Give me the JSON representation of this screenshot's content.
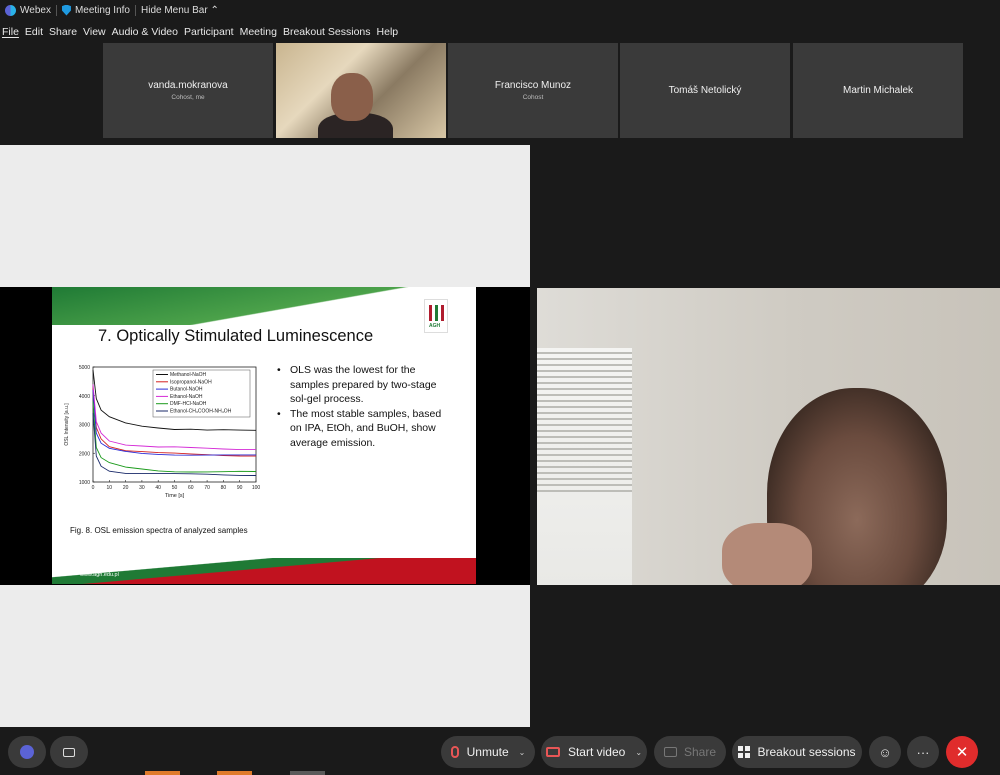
{
  "titlebar": {
    "app_name": "Webex",
    "meeting_info": "Meeting Info",
    "hide_menu": "Hide Menu Bar ⌃"
  },
  "menu": [
    "File",
    "Edit",
    "Share",
    "View",
    "Audio & Video",
    "Participant",
    "Meeting",
    "Breakout Sessions",
    "Help"
  ],
  "participants": [
    {
      "name": "vanda.mokranova",
      "role": "Cohost, me"
    },
    {
      "name": "",
      "role": "",
      "video": true
    },
    {
      "name": "Francisco Munoz",
      "role": "Cohost"
    },
    {
      "name": "Tomáš Netolický",
      "role": ""
    },
    {
      "name": "Martin Michalek",
      "role": ""
    }
  ],
  "slide": {
    "title": "7. Optically Stimulated Luminescence",
    "bullets": [
      "OLS was the lowest for the samples prepared by two-stage sol-gel process.",
      "The most stable samples, based on IPA, EtOh, and BuOH, show average emission."
    ],
    "caption": "Fig. 8. OSL emission spectra of analyzed samples",
    "footer": "www.agh.edu.pl",
    "logo_text": "AGH"
  },
  "chart_data": {
    "type": "line",
    "xlabel": "Time [s]",
    "ylabel": "OSL Intensity [a.u.]",
    "xlim": [
      0,
      100
    ],
    "ylim": [
      1000,
      5000
    ],
    "xticks": [
      0,
      10,
      20,
      30,
      40,
      50,
      60,
      70,
      80,
      90,
      100
    ],
    "yticks": [
      1000,
      2000,
      3000,
      4000,
      5000
    ],
    "x": [
      0,
      2,
      5,
      10,
      20,
      30,
      40,
      50,
      60,
      70,
      80,
      90,
      100
    ],
    "series": [
      {
        "name": "Methanol-NaOH",
        "color": "#111111",
        "values": [
          4900,
          3900,
          3500,
          3250,
          3050,
          2950,
          2900,
          2850,
          2850,
          2800,
          2800,
          2780,
          2780
        ]
      },
      {
        "name": "Isopropanol-NaOH",
        "color": "#d42020",
        "values": [
          4300,
          2900,
          2500,
          2250,
          2100,
          2050,
          2000,
          1980,
          1960,
          1950,
          1940,
          1930,
          1920
        ]
      },
      {
        "name": "Butanol-NaOH",
        "color": "#2a2ad6",
        "values": [
          4200,
          2700,
          2350,
          2150,
          2050,
          2000,
          1980,
          1960,
          1950,
          1940,
          1930,
          1920,
          1920
        ]
      },
      {
        "name": "Ethanol-NaOH",
        "color": "#d42ad6",
        "values": [
          4400,
          3100,
          2700,
          2450,
          2300,
          2250,
          2200,
          2200,
          2180,
          2170,
          2160,
          2150,
          2150
        ]
      },
      {
        "name": "DMF-HCl-NaOH",
        "color": "#1a9a1a",
        "values": [
          3800,
          2200,
          1850,
          1650,
          1500,
          1450,
          1400,
          1380,
          1370,
          1360,
          1350,
          1350,
          1340
        ]
      },
      {
        "name": "Ethanol-CH₃COOH-NH₄OH",
        "color": "#1a2a6a",
        "values": [
          3400,
          1900,
          1550,
          1400,
          1320,
          1300,
          1280,
          1270,
          1260,
          1260,
          1250,
          1250,
          1250
        ]
      }
    ]
  },
  "toolbar": {
    "unmute": "Unmute",
    "start_video": "Start video",
    "share": "Share",
    "breakout": "Breakout sessions",
    "more": "···",
    "leave": "✕"
  },
  "colors": {
    "leave": "#e02c2c",
    "muted": "#e85656"
  }
}
